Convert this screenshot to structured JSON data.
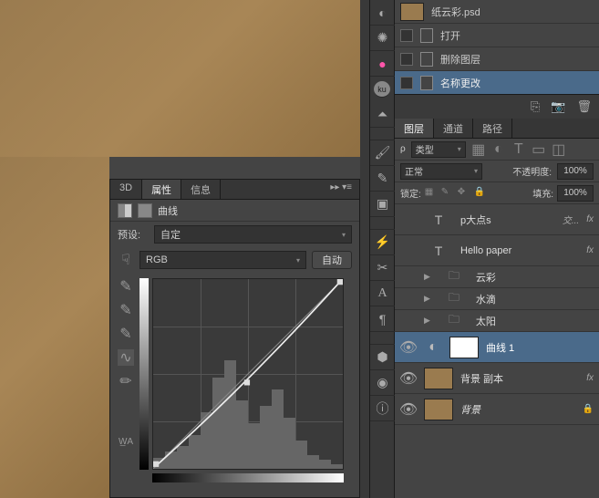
{
  "canvas_color": "#9a7b4f",
  "properties_panel": {
    "tabs": [
      "3D",
      "属性",
      "信息"
    ],
    "active_tab": 1,
    "title": "曲线",
    "preset_label": "预设:",
    "preset_value": "自定",
    "channel_value": "RGB",
    "auto_button": "自动"
  },
  "history_panel": {
    "items": [
      {
        "label": "纸云彩.psd",
        "thumb": true
      },
      {
        "label": "打开"
      },
      {
        "label": "删除图层"
      },
      {
        "label": "名称更改",
        "selected": true
      }
    ]
  },
  "layers_panel": {
    "tabs": [
      "图层",
      "通道",
      "路径"
    ],
    "active_tab": 0,
    "kind_label": "类型",
    "blend_mode": "正常",
    "opacity_label": "不透明度:",
    "opacity_value": "100%",
    "lock_label": "锁定:",
    "fill_label": "填充:",
    "fill_value": "100%",
    "layers": [
      {
        "name": "p大点s",
        "type": "text",
        "fx": true,
        "extra": "交..."
      },
      {
        "name": "Hello paper",
        "type": "text",
        "fx": true
      },
      {
        "name": "云彩",
        "type": "group"
      },
      {
        "name": "水滴",
        "type": "group"
      },
      {
        "name": "太阳",
        "type": "group"
      },
      {
        "name": "曲线 1",
        "type": "adjustment",
        "selected": true,
        "visible": true
      },
      {
        "name": "背景 副本",
        "type": "raster",
        "thumb": "brown",
        "visible": true,
        "fx": true
      },
      {
        "name": "背景",
        "type": "raster",
        "thumb": "brown",
        "visible": true,
        "locked": true,
        "italic": true
      }
    ]
  }
}
